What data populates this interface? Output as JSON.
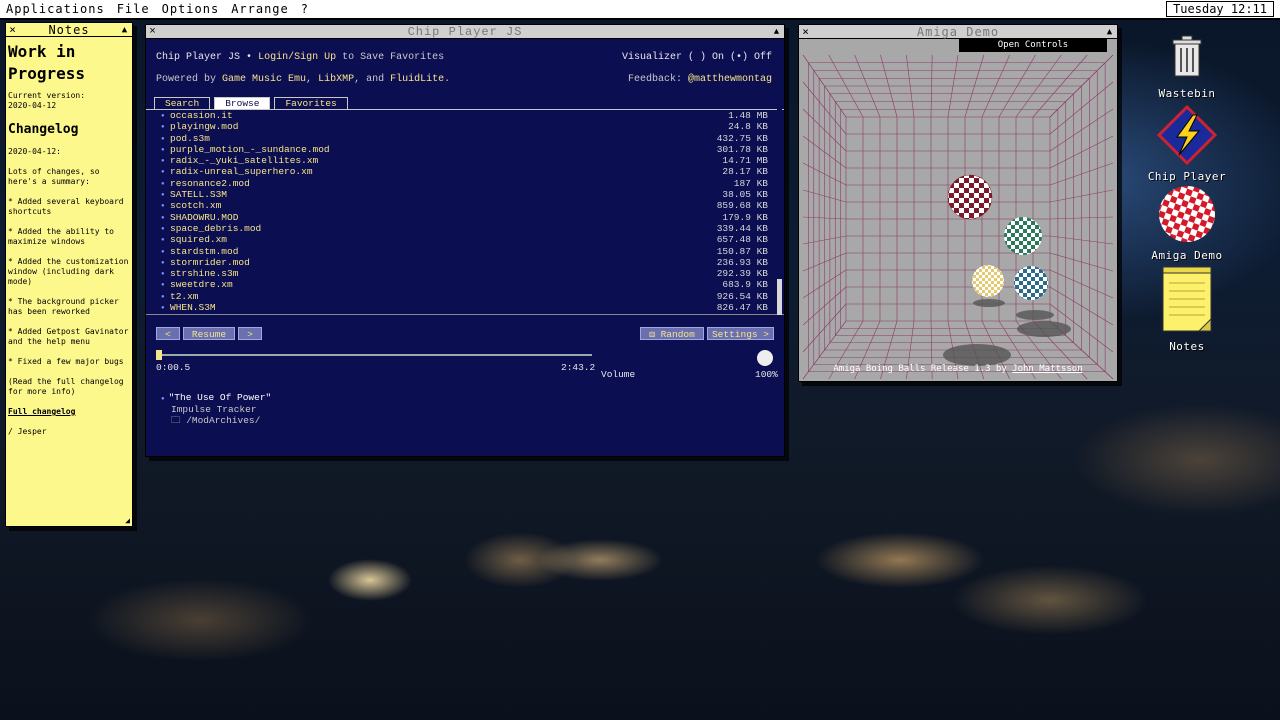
{
  "menubar": {
    "items": [
      "Applications",
      "File",
      "Options",
      "Arrange",
      "?"
    ],
    "clock": "Tuesday 12:11"
  },
  "notes": {
    "title": "Notes",
    "heading": "Work in Progress",
    "version_label": "Current version:",
    "version": "2020-04-12",
    "changelog_title": "Changelog",
    "date": "2020-04-12:",
    "intro": "Lots of changes, so here's a summary:",
    "items": [
      "* Added several keyboard shortcuts",
      "* Added the ability to maximize windows",
      "* Added the customization window (including dark mode)",
      "* The background picker has been reworked",
      "* Added Getpost Gavinator and the help menu",
      "* Fixed a few major bugs",
      "(Read the full changelog for more info)"
    ],
    "link": "Full changelog",
    "signature": "/ Jesper"
  },
  "chip_player": {
    "title": "Chip Player JS",
    "app_name": "Chip Player JS",
    "sep": "•",
    "login": "Login/Sign Up",
    "login_suffix": "to Save Favorites",
    "powered_prefix": "Powered by",
    "powered_1": "Game Music Emu",
    "powered_2": "LibXMP",
    "powered_and": "and",
    "powered_3": "FluidLite",
    "visualizer": "Visualizer ( ) On (•) Off",
    "feedback_label": "Feedback:",
    "feedback_handle": "@matthewmontag",
    "tabs": [
      "Search",
      "Browse",
      "Favorites"
    ],
    "files": [
      {
        "name": "occasion.it",
        "size": "1.48 MB"
      },
      {
        "name": "playingw.mod",
        "size": "24.8 KB"
      },
      {
        "name": "pod.s3m",
        "size": "432.75 KB"
      },
      {
        "name": "purple_motion_-_sundance.mod",
        "size": "301.78 KB"
      },
      {
        "name": "radix_-_yuki_satellites.xm",
        "size": "14.71 MB"
      },
      {
        "name": "radix-unreal_superhero.xm",
        "size": "28.17 KB"
      },
      {
        "name": "resonance2.mod",
        "size": "187 KB"
      },
      {
        "name": "SATELL.S3M",
        "size": "38.05 KB"
      },
      {
        "name": "scotch.xm",
        "size": "859.68 KB"
      },
      {
        "name": "SHADOWRU.MOD",
        "size": "179.9 KB"
      },
      {
        "name": "space_debris.mod",
        "size": "339.44 KB"
      },
      {
        "name": "squired.xm",
        "size": "657.48 KB"
      },
      {
        "name": "stardstm.mod",
        "size": "150.87 KB"
      },
      {
        "name": "stormrider.mod",
        "size": "236.93 KB"
      },
      {
        "name": "strshine.s3m",
        "size": "292.39 KB"
      },
      {
        "name": "sweetdre.xm",
        "size": "683.9 KB"
      },
      {
        "name": "t2.xm",
        "size": "926.54 KB"
      },
      {
        "name": "WHEN.S3M",
        "size": "826.47 KB"
      }
    ],
    "prev": "<",
    "resume": "Resume",
    "next": ">",
    "random": "⚄ Random",
    "settings": "Settings >",
    "time_current": "0:00.5",
    "time_total": "2:43.2",
    "volume_label": "Volume",
    "volume_value": "100%",
    "track_title": "\"The Use Of Power\"",
    "track_format": "Impulse Tracker",
    "track_path": "🗀 /ModArchives/"
  },
  "amiga": {
    "title": "Amiga Demo",
    "open_controls": "Open Controls",
    "caption": "Amiga Boing Balls Release 1.3 by",
    "author": "John Mattsson"
  },
  "desktop": {
    "icons": [
      {
        "label": "Wastebin",
        "icon": "wastebin-icon"
      },
      {
        "label": "Chip Player",
        "icon": "chip-player-icon"
      },
      {
        "label": "Amiga Demo",
        "icon": "amiga-demo-icon"
      },
      {
        "label": "Notes",
        "icon": "notes-icon"
      }
    ]
  },
  "colors": {
    "chip_bg": "#0c0e52",
    "accent_yellow": "#f6e58a",
    "notes_bg": "#fdf88c"
  }
}
